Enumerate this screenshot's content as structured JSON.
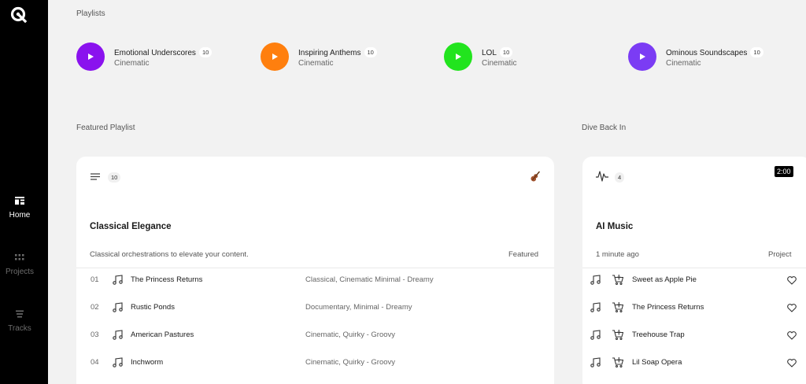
{
  "nav": {
    "home": "Home",
    "projects": "Projects",
    "tracks": "Tracks"
  },
  "playlists": {
    "label": "Playlists",
    "items": [
      {
        "name": "Emotional Underscores",
        "count": "10",
        "genre": "Cinematic",
        "color": "#8a12ee"
      },
      {
        "name": "Inspiring Anthems",
        "count": "10",
        "genre": "Cinematic",
        "color": "#ff7f0e"
      },
      {
        "name": "LOL",
        "count": "10",
        "genre": "Cinematic",
        "color": "#22e41e"
      },
      {
        "name": "Ominous Soundscapes",
        "count": "10",
        "genre": "Cinematic",
        "color": "#7b3cf4"
      }
    ]
  },
  "featured": {
    "label": "Featured Playlist",
    "count": "10",
    "icon": "violin-icon",
    "title": "Classical Elegance",
    "description": "Classical orchestrations to elevate your content.",
    "tag": "Featured",
    "tracks": [
      {
        "num": "01",
        "name": "The Princess Returns",
        "genre": "Classical, Cinematic Minimal - Dreamy"
      },
      {
        "num": "02",
        "name": "Rustic Ponds",
        "genre": "Documentary, Minimal - Dreamy"
      },
      {
        "num": "03",
        "name": "American Pastures",
        "genre": "Cinematic, Quirky - Groovy"
      },
      {
        "num": "04",
        "name": "Inchworm",
        "genre": "Cinematic, Quirky - Groovy"
      }
    ]
  },
  "dive": {
    "label": "Dive Back In",
    "count": "4",
    "duration": "2:00",
    "title": "AI Music",
    "updated": "1 minute ago",
    "tag": "Project",
    "tracks": [
      {
        "name": "Sweet as Apple Pie"
      },
      {
        "name": "The Princess Returns"
      },
      {
        "name": "Treehouse Trap"
      },
      {
        "name": "Lil Soap Opera"
      }
    ]
  }
}
